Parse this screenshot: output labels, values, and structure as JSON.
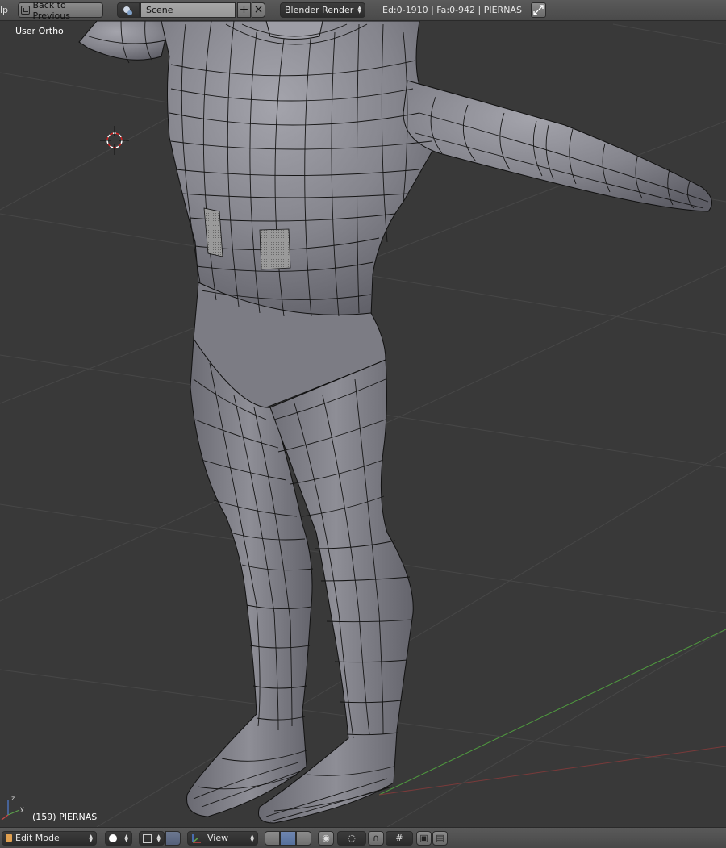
{
  "top_header": {
    "help_menu_fragment": "lp",
    "back_button_label": "Back to Previous",
    "scene_name": "Scene",
    "scene_add_icon": "plus-icon",
    "scene_delete_icon": "x-icon",
    "render_engine": "Blender Render",
    "stats": "Ed:0-1910 | Fa:0-942 | PIERNAS",
    "fullscreen_icon": "fullscreen-toggle-icon"
  },
  "viewport": {
    "view_label": "User Ortho",
    "object_label": "(159) PIERNAS",
    "colors": {
      "background": "#393939",
      "grid": "#4a4a4a",
      "x_axis": "#c14a4a",
      "y_axis": "#58a048",
      "mesh_fill": "#8c8c94",
      "mesh_wire": "#111111"
    }
  },
  "bottom_header": {
    "mode": "Edit Mode",
    "viewport_shading": "solid-sphere-icon",
    "pivot_icon": "pivot-point-icon",
    "view_menu": "View",
    "select_modes": [
      "vertex-select-icon",
      "edge-select-icon",
      "face-select-icon"
    ],
    "proportional_icon": "proportional-edit-icon",
    "snap_icon": "snap-magnet-icon",
    "grid_icon": "grid-snap-icon",
    "render_icons": [
      "opengl-render-icon",
      "opengl-animation-icon"
    ]
  }
}
